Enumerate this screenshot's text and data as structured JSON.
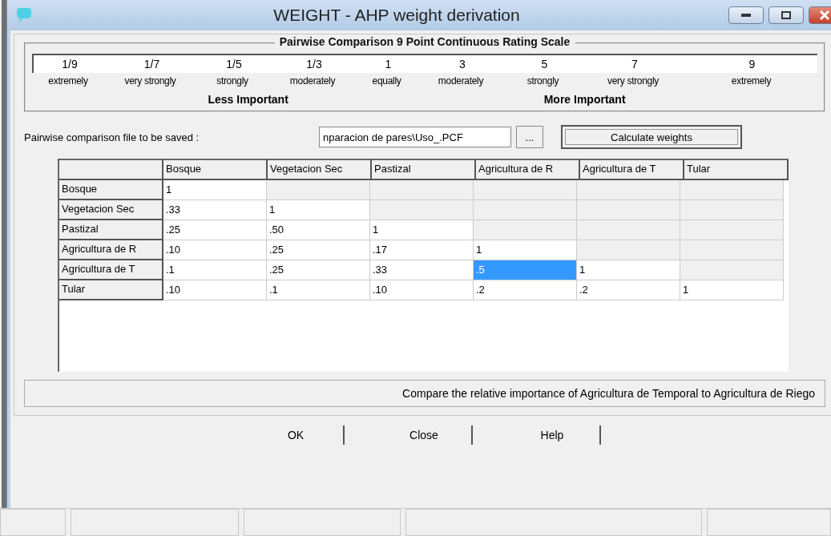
{
  "window": {
    "title": "WEIGHT - AHP weight derivation"
  },
  "scale": {
    "title": "Pairwise Comparison 9 Point Continuous Rating Scale",
    "points": [
      {
        "value": "1/9",
        "label": "extremely"
      },
      {
        "value": "1/7",
        "label": "very strongly"
      },
      {
        "value": "1/5",
        "label": "strongly"
      },
      {
        "value": "1/3",
        "label": "moderately"
      },
      {
        "value": "1",
        "label": "equally"
      },
      {
        "value": "3",
        "label": "moderately"
      },
      {
        "value": "5",
        "label": "strongly"
      },
      {
        "value": "7",
        "label": "very strongly"
      },
      {
        "value": "9",
        "label": "extremely"
      }
    ],
    "less_label": "Less Important",
    "more_label": "More Important"
  },
  "file": {
    "label": "Pairwise comparison file to be saved :",
    "value": "nparacion de pares\\Uso_.PCF",
    "browse": "...",
    "calculate": "Calculate weights"
  },
  "matrix": {
    "columns": [
      "Bosque",
      "Vegetacion Sec",
      "Pastizal",
      "Agricultura de R",
      "Agricultura de T",
      "Tular"
    ],
    "rows": [
      {
        "label": "Bosque",
        "cells": [
          {
            "value": "1",
            "selected": false
          }
        ]
      },
      {
        "label": "Vegetacion Sec",
        "cells": [
          {
            "value": ".33",
            "selected": false
          },
          {
            "value": "1",
            "selected": false
          }
        ]
      },
      {
        "label": "Pastizal",
        "cells": [
          {
            "value": ".25",
            "selected": false
          },
          {
            "value": ".50",
            "selected": false
          },
          {
            "value": "1",
            "selected": false
          }
        ]
      },
      {
        "label": "Agricultura de R",
        "cells": [
          {
            "value": ".10",
            "selected": false
          },
          {
            "value": ".25",
            "selected": false
          },
          {
            "value": ".17",
            "selected": false
          },
          {
            "value": "1",
            "selected": false
          }
        ]
      },
      {
        "label": "Agricultura de T",
        "cells": [
          {
            "value": ".1",
            "selected": false
          },
          {
            "value": ".25",
            "selected": false
          },
          {
            "value": ".33",
            "selected": false
          },
          {
            "value": ".5",
            "selected": true
          },
          {
            "value": "1",
            "selected": false
          }
        ]
      },
      {
        "label": "Tular",
        "cells": [
          {
            "value": ".10",
            "selected": false
          },
          {
            "value": ".1",
            "selected": false
          },
          {
            "value": ".10",
            "selected": false
          },
          {
            "value": ".2",
            "selected": false
          },
          {
            "value": ".2",
            "selected": false
          },
          {
            "value": "1",
            "selected": false
          }
        ]
      }
    ]
  },
  "prompt": "Compare the relative importance of Agricultura de Temporal  to Agricultura de Riego",
  "buttons": [
    "OK",
    "Close",
    "Help"
  ]
}
